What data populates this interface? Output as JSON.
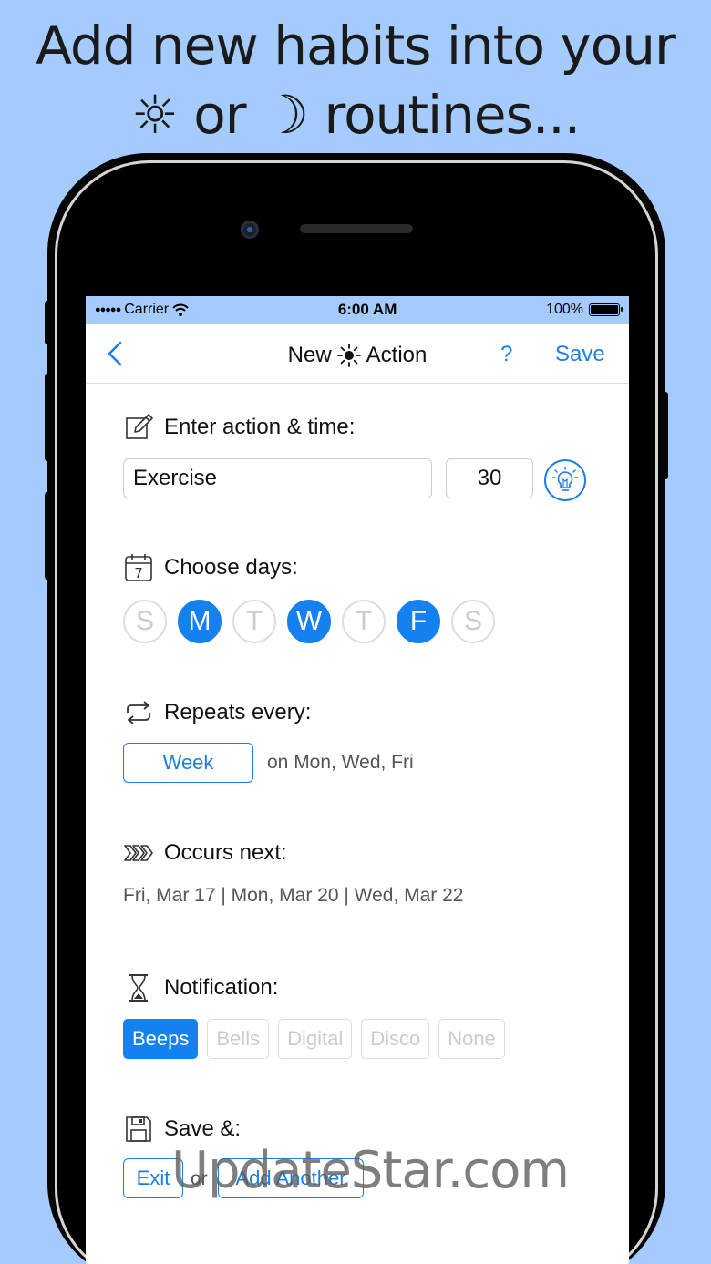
{
  "headline": {
    "line1": "Add new habits into your",
    "line2_sun": "☼",
    "line2_or": "or",
    "line2_moon": "☽",
    "line2_rest": "routines..."
  },
  "status_bar": {
    "signal": "●●●●●",
    "carrier": "Carrier",
    "time": "6:00 AM",
    "battery": "100%"
  },
  "nav": {
    "title_left": "New",
    "title_right": "Action",
    "help": "?",
    "save": "Save"
  },
  "action": {
    "heading": "Enter action & time:",
    "name_value": "Exercise",
    "minutes_value": "30"
  },
  "days": {
    "heading": "Choose days:",
    "calendar_day": "7",
    "items": [
      {
        "letter": "S",
        "selected": false
      },
      {
        "letter": "M",
        "selected": true
      },
      {
        "letter": "T",
        "selected": false
      },
      {
        "letter": "W",
        "selected": true
      },
      {
        "letter": "T",
        "selected": false
      },
      {
        "letter": "F",
        "selected": true
      },
      {
        "letter": "S",
        "selected": false
      }
    ]
  },
  "repeat": {
    "heading": "Repeats every:",
    "unit": "Week",
    "detail": "on Mon, Wed, Fri"
  },
  "next": {
    "heading": "Occurs next:",
    "dates": "Fri, Mar 17 | Mon, Mar 20 | Wed, Mar 22"
  },
  "notification": {
    "heading": "Notification:",
    "options": [
      {
        "label": "Beeps",
        "selected": true
      },
      {
        "label": "Bells",
        "selected": false
      },
      {
        "label": "Digital",
        "selected": false
      },
      {
        "label": "Disco",
        "selected": false
      },
      {
        "label": "None",
        "selected": false
      }
    ]
  },
  "save_section": {
    "heading": "Save &:",
    "exit": "Exit",
    "or": "or",
    "add_another": "Add Another"
  },
  "watermark": "UpdateStar.com",
  "colors": {
    "background": "#a4cbfb",
    "accent": "#1580f0",
    "link": "#1a7ee8"
  }
}
